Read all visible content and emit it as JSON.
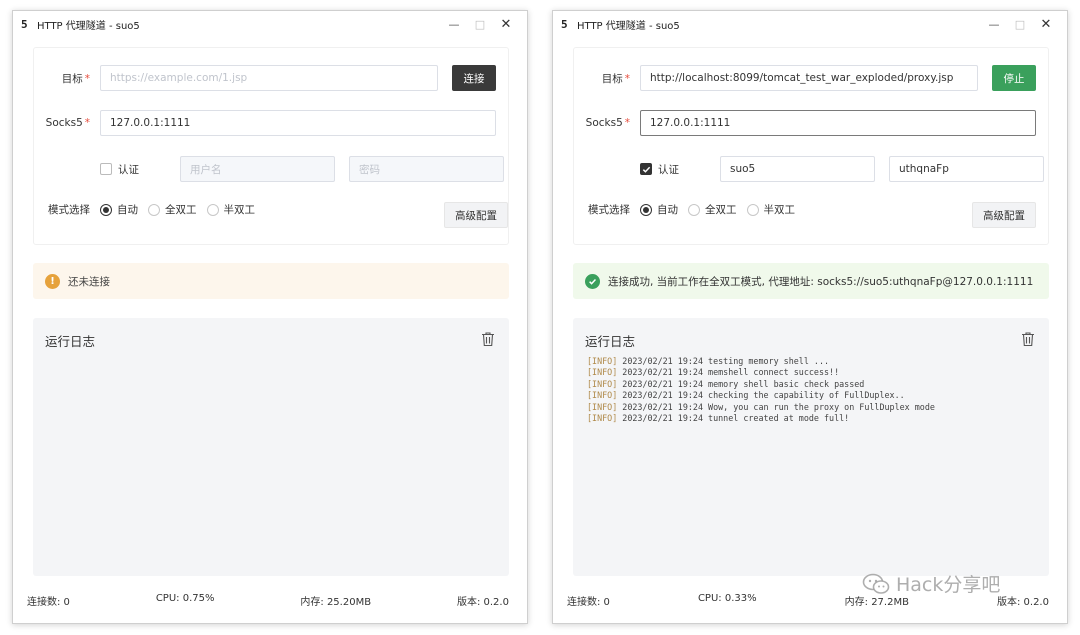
{
  "windows": [
    {
      "id": "left",
      "title": "HTTP 代理隧道 - suo5",
      "app_logo": "5",
      "window_controls": {
        "minimize": "—",
        "maximize": "□",
        "close": "✕"
      },
      "target": {
        "label": "目标",
        "required_mark": "*",
        "value": "",
        "placeholder": "https://example.com/1.jsp"
      },
      "action_button": "连接",
      "socks5": {
        "label": "Socks5",
        "required_mark": "*",
        "value": "127.0.0.1:1111"
      },
      "auth": {
        "label": "认证",
        "checked": false,
        "username": "",
        "username_placeholder": "用户名",
        "password": "",
        "password_placeholder": "密码"
      },
      "mode": {
        "label": "模式选择",
        "options": [
          "自动",
          "全双工",
          "半双工"
        ],
        "selected": "自动"
      },
      "advanced_button": "高级配置",
      "alert": {
        "type": "warning",
        "icon": "warning-icon",
        "text": "还未连接"
      },
      "log": {
        "title": "运行日志",
        "lines": []
      },
      "status": {
        "connections": "连接数: 0",
        "cpu": "CPU: 0.75%",
        "memory": "内存: 25.20MB",
        "version": "版本: 0.2.0"
      }
    },
    {
      "id": "right",
      "title": "HTTP 代理隧道 - suo5",
      "app_logo": "5",
      "window_controls": {
        "minimize": "—",
        "maximize": "□",
        "close": "✕"
      },
      "target": {
        "label": "目标",
        "required_mark": "*",
        "value": "http://localhost:8099/tomcat_test_war_exploded/proxy.jsp",
        "placeholder": ""
      },
      "action_button": "停止",
      "socks5": {
        "label": "Socks5",
        "required_mark": "*",
        "value": "127.0.0.1:1111"
      },
      "auth": {
        "label": "认证",
        "checked": true,
        "username": "suo5",
        "username_placeholder": "",
        "password": "uthqnaFp",
        "password_placeholder": ""
      },
      "mode": {
        "label": "模式选择",
        "options": [
          "自动",
          "全双工",
          "半双工"
        ],
        "selected": "自动"
      },
      "advanced_button": "高级配置",
      "alert": {
        "type": "success",
        "icon": "check-circle-icon",
        "text": "连接成功, 当前工作在全双工模式, 代理地址: socks5://suo5:uthqnaFp@127.0.0.1:1111"
      },
      "log": {
        "title": "运行日志",
        "lines": [
          {
            "tag": "[INFO]",
            "text": " 2023/02/21 19:24 testing memory shell ..."
          },
          {
            "tag": "[INFO]",
            "text": " 2023/02/21 19:24 memshell connect success!!"
          },
          {
            "tag": "[INFO]",
            "text": " 2023/02/21 19:24 memory shell basic check passed"
          },
          {
            "tag": "[INFO]",
            "text": " 2023/02/21 19:24 checking the capability of FullDuplex.."
          },
          {
            "tag": "[INFO]",
            "text": " 2023/02/21 19:24 Wow, you can run the proxy on FullDuplex mode"
          },
          {
            "tag": "[INFO]",
            "text": " 2023/02/21 19:24 tunnel created at mode full!"
          }
        ]
      },
      "status": {
        "connections": "连接数: 0",
        "cpu": "CPU: 0.33%",
        "memory": "内存: 27.2MB",
        "version": "版本: 0.2.0"
      }
    }
  ],
  "watermark": {
    "text": "Hack分享吧",
    "icon": "wechat-icon"
  },
  "colors": {
    "dark_button": "#3a3a3a",
    "success_green": "#3aa05c",
    "warning_orange": "#e6a23c",
    "warning_bg": "#fdf6ec",
    "success_bg": "#f0f9eb",
    "log_bg": "#f4f5f7"
  }
}
